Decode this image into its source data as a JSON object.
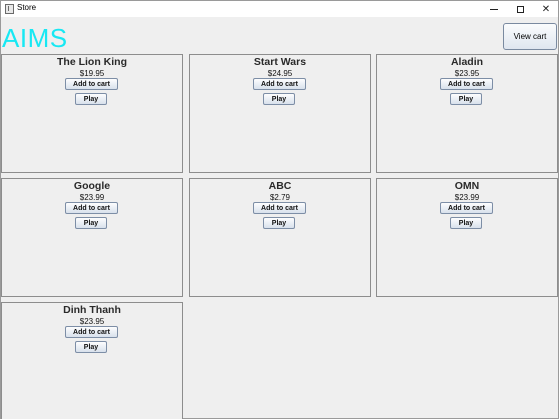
{
  "window": {
    "title": "Store",
    "minimize_label": "–",
    "maximize_label": "",
    "close_label": "✕"
  },
  "header": {
    "title": "AIMS",
    "title_color": "#17e8f3",
    "view_cart_label": "View cart"
  },
  "products": [
    {
      "title": "The Lion King",
      "price": "$19.95",
      "add_label": "Add to cart",
      "play_label": "Play"
    },
    {
      "title": "Start Wars",
      "price": "$24.95",
      "add_label": "Add to cart",
      "play_label": "Play"
    },
    {
      "title": "Aladin",
      "price": "$23.95",
      "add_label": "Add to cart",
      "play_label": "Play"
    },
    {
      "title": "Google",
      "price": "$23.99",
      "add_label": "Add to cart",
      "play_label": "Play"
    },
    {
      "title": "ABC",
      "price": "$2.79",
      "add_label": "Add to cart",
      "play_label": "Play"
    },
    {
      "title": "OMN",
      "price": "$23.99",
      "add_label": "Add to cart",
      "play_label": "Play"
    },
    {
      "title": "Dinh Thanh",
      "price": "$23.95",
      "add_label": "Add to cart",
      "play_label": "Play"
    }
  ]
}
